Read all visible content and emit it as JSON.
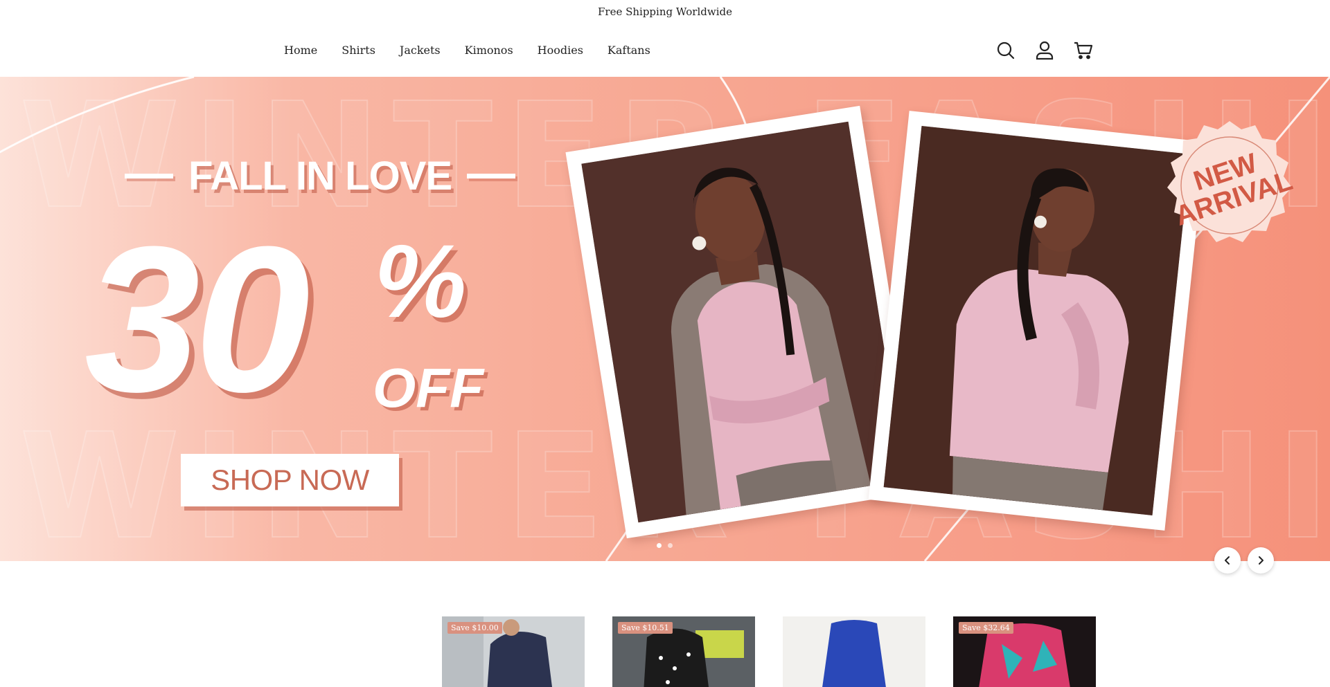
{
  "announcement": {
    "text": "Free Shipping Worldwide"
  },
  "nav": {
    "items": [
      {
        "label": "Home"
      },
      {
        "label": "Shirts"
      },
      {
        "label": "Jackets"
      },
      {
        "label": "Kimonos"
      },
      {
        "label": "Hoodies"
      },
      {
        "label": "Kaftans"
      }
    ]
  },
  "header_icons": [
    "search-icon",
    "account-icon",
    "cart-icon"
  ],
  "hero": {
    "background_word_1": "WINTER FASHION",
    "background_word_2": "WINTER FASHION",
    "tagline": "FALL IN LOVE",
    "discount_number": "30",
    "discount_percent": "%",
    "discount_off": "OFF",
    "cta_label": "SHOP NOW",
    "badge_line_1": "NEW",
    "badge_line_2": "ARRIVAL",
    "slide_count": 2,
    "active_slide": 1
  },
  "colors": {
    "hero_accent": "#f7a893",
    "cta_text": "#c86a55",
    "badge_text": "#d25a45",
    "sale_badge": "#d9917f"
  },
  "products": [
    {
      "sale_label": "Save $10.00"
    },
    {
      "sale_label": "Save $10.51"
    },
    {
      "sale_label": ""
    },
    {
      "sale_label": "Save $32.64"
    }
  ]
}
